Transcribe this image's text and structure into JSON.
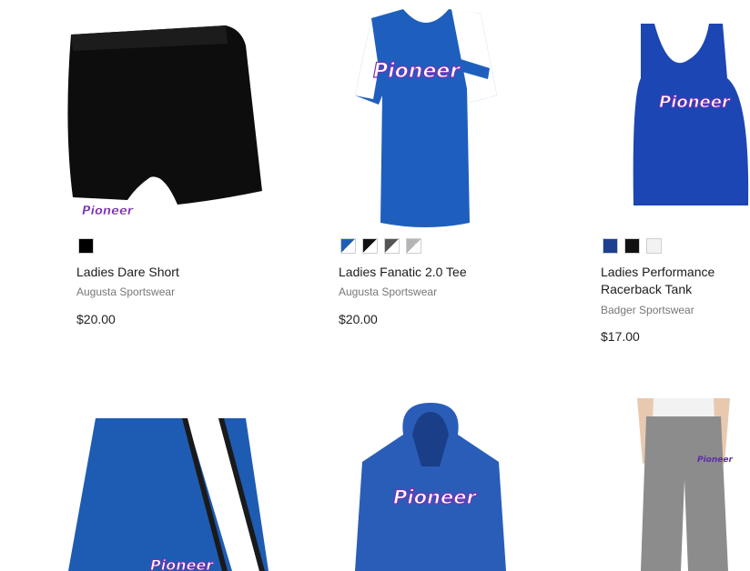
{
  "products": [
    {
      "name": "Ladies Dare Short",
      "brand": "Augusta Sportswear",
      "price": "$20.00",
      "image_logo": "Pioneer",
      "swatches": [
        "#000000"
      ]
    },
    {
      "name": "Ladies Fanatic 2.0 Tee",
      "brand": "Augusta Sportswear",
      "price": "$20.00",
      "image_logo": "Pioneer",
      "swatches": [
        "#1e5fb4/#ffffff",
        "#111111/#ffffff",
        "#555555/#ffffff",
        "#b5b5b5/#ffffff"
      ]
    },
    {
      "name": "Ladies Performance Racerback Tank",
      "brand": "Badger Sportswear",
      "price": "$17.00",
      "image_logo": "Pioneer",
      "swatches": [
        "#1c3f8f",
        "#111111",
        "#f2f2f2"
      ]
    },
    {
      "image_logo": "Pioneer"
    },
    {
      "image_logo": "Pioneer"
    },
    {
      "image_logo": "Pioneer"
    }
  ],
  "colors": {
    "royal": "#1f5fc0",
    "logo_purple": "#7b2fb5",
    "logo_pink": "#e04fb0"
  }
}
